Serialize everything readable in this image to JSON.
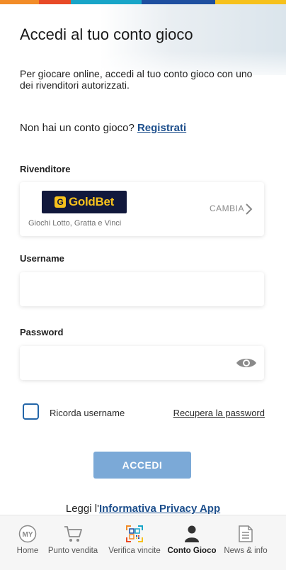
{
  "colors": {
    "top_stripe": [
      "#f28c28",
      "#e84a27",
      "#18a5c8",
      "#1e4fa0",
      "#f6c11c"
    ],
    "link": "#1d4f8c",
    "button": "#7ba9d7",
    "checkbox_border": "#2466a8",
    "goldbet_bg": "#11183c",
    "goldbet_text": "#f6c11c"
  },
  "header": {
    "title": "Accedi al tuo conto gioco",
    "intro": "Per giocare online, accedi al tuo conto gioco con uno dei rivenditori autorizzati."
  },
  "register": {
    "prompt": "Non hai un conto gioco?",
    "link_label": "Registrati"
  },
  "reseller": {
    "label": "Rivenditore",
    "logo_text": "GoldBet",
    "subtitle": "Giochi Lotto, Gratta e Vinci",
    "change_label": "CAMBIA"
  },
  "username": {
    "label": "Username",
    "value": ""
  },
  "password": {
    "label": "Password",
    "value": ""
  },
  "remember": {
    "label": "Ricorda username",
    "checked": false
  },
  "recover": {
    "label": "Recupera la password"
  },
  "submit": {
    "label": "ACCEDI"
  },
  "privacy": {
    "prefix": "Leggi l'",
    "link_label": "Informativa Privacy App"
  },
  "nav": {
    "items": [
      {
        "label": "Home",
        "icon": "my-home-icon",
        "active": false
      },
      {
        "label": "Punto vendita",
        "icon": "cart-icon",
        "active": false
      },
      {
        "label": "Verifica vincite",
        "icon": "qr-code-icon",
        "active": false
      },
      {
        "label": "Conto Gioco",
        "icon": "user-icon",
        "active": true
      },
      {
        "label": "News & info",
        "icon": "news-icon",
        "active": false
      }
    ]
  }
}
